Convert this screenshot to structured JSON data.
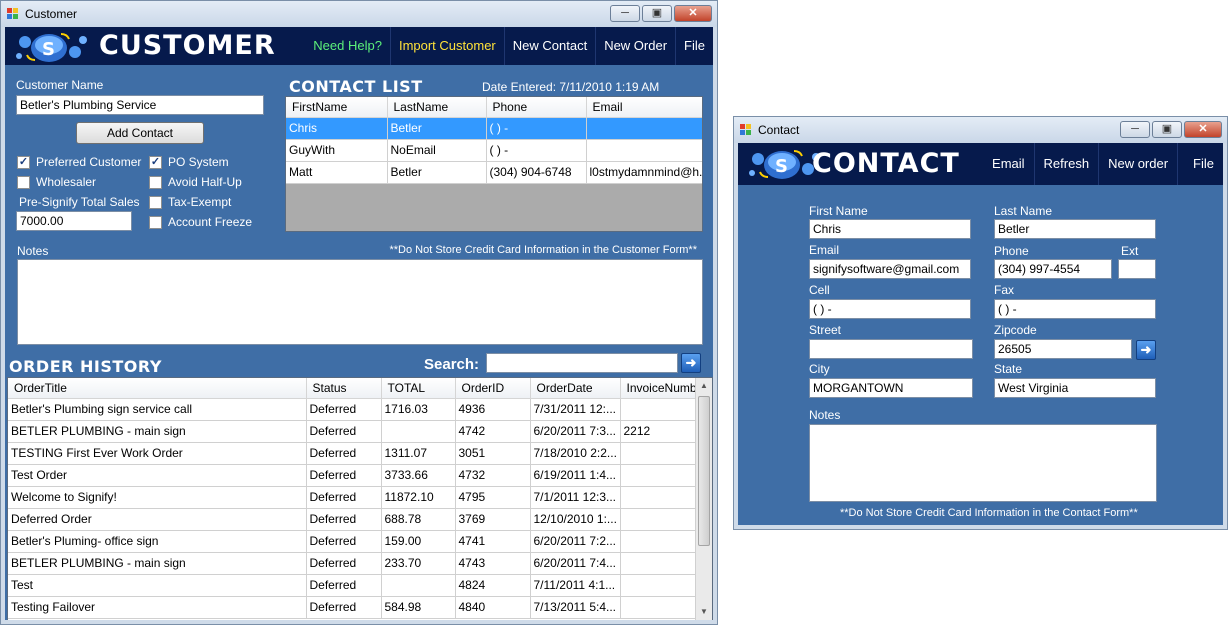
{
  "customer_window": {
    "title": "Customer",
    "brand": "CUSTOMER",
    "menu": [
      {
        "label": "Need Help?",
        "color": "#5cf07a"
      },
      {
        "label": "Import Customer",
        "color": "#ffe23a"
      },
      {
        "label": "New Contact",
        "color": "#ffffff"
      },
      {
        "label": "New Order",
        "color": "#ffffff"
      },
      {
        "label": "File",
        "color": "#ffffff"
      }
    ],
    "customer_name_label": "Customer Name",
    "customer_name_value": "Betler's Plumbing Service",
    "add_contact_label": "Add Contact",
    "checkboxes": {
      "preferred_customer": {
        "label": "Preferred Customer",
        "checked": "✓"
      },
      "po_system": {
        "label": "PO System",
        "checked": "✓"
      },
      "wholesaler": {
        "label": "Wholesaler",
        "checked": ""
      },
      "avoid_half_up": {
        "label": "Avoid Half-Up",
        "checked": ""
      },
      "tax_exempt": {
        "label": "Tax-Exempt",
        "checked": ""
      },
      "account_freeze": {
        "label": "Account Freeze",
        "checked": ""
      }
    },
    "pre_signify_label": "Pre-Signify Total Sales",
    "pre_signify_value": "7000.00",
    "contact_list_title": "CONTACT LIST",
    "date_entered": "Date Entered: 7/11/2010 1:19 AM",
    "contact_columns": [
      "FirstName",
      "LastName",
      "Phone",
      "Email"
    ],
    "contact_rows": [
      [
        "Chris",
        "Betler",
        "(   )    -",
        ""
      ],
      [
        "GuyWith",
        "NoEmail",
        "(   )    -",
        ""
      ],
      [
        "Matt",
        "Betler",
        "(304) 904-6748",
        "l0stmydamnmind@h..."
      ]
    ],
    "notes_label": "Notes",
    "notes_warning": "**Do Not Store Credit Card Information in the Customer Form**",
    "order_history_title": "ORDER HISTORY",
    "search_label": "Search:",
    "search_value": "",
    "order_columns": [
      "OrderTitle",
      "Status",
      "TOTAL",
      "OrderID",
      "OrderDate",
      "InvoiceNumbe"
    ],
    "order_rows": [
      [
        "Betler's Plumbing sign service call",
        "Deferred",
        "1716.03",
        "4936",
        "7/31/2011 12:...",
        ""
      ],
      [
        "BETLER PLUMBING - main sign",
        "Deferred",
        "",
        "4742",
        "6/20/2011 7:3...",
        "2212"
      ],
      [
        "TESTING First Ever Work Order",
        "Deferred",
        "1311.07",
        "3051",
        "7/18/2010 2:2...",
        ""
      ],
      [
        "Test Order",
        "Deferred",
        "3733.66",
        "4732",
        "6/19/2011 1:4...",
        ""
      ],
      [
        "Welcome to Signify!",
        "Deferred",
        "11872.10",
        "4795",
        "7/1/2011 12:3...",
        ""
      ],
      [
        "Deferred Order",
        "Deferred",
        "688.78",
        "3769",
        "12/10/2010 1:...",
        ""
      ],
      [
        "Betler's Pluming- office sign",
        "Deferred",
        "159.00",
        "4741",
        "6/20/2011 7:2...",
        ""
      ],
      [
        "BETLER PLUMBING - main sign",
        "Deferred",
        "233.70",
        "4743",
        "6/20/2011 7:4...",
        ""
      ],
      [
        "Test",
        "Deferred",
        "",
        "4824",
        "7/11/2011 4:1...",
        ""
      ],
      [
        "Testing Failover",
        "Deferred",
        "584.98",
        "4840",
        "7/13/2011 5:4...",
        ""
      ]
    ]
  },
  "contact_window": {
    "title": "Contact",
    "brand": "CONTACT",
    "menu": [
      "Email",
      "Refresh",
      "New order",
      "File"
    ],
    "fields": {
      "first_name": {
        "label": "First Name",
        "value": "Chris"
      },
      "last_name": {
        "label": "Last Name",
        "value": "Betler"
      },
      "email": {
        "label": "Email",
        "value": "signifysoftware@gmail.com"
      },
      "phone": {
        "label": "Phone",
        "value": "(304) 997-4554"
      },
      "ext": {
        "label": "Ext",
        "value": ""
      },
      "cell": {
        "label": "Cell",
        "value": "(   )    -"
      },
      "fax": {
        "label": "Fax",
        "value": "(   )    -"
      },
      "street": {
        "label": "Street",
        "value": ""
      },
      "zipcode": {
        "label": "Zipcode",
        "value": "26505"
      },
      "city": {
        "label": "City",
        "value": "MORGANTOWN"
      },
      "state": {
        "label": "State",
        "value": "West Virginia"
      }
    },
    "notes_label": "Notes",
    "notes_warning": "**Do Not Store Credit Card Information in the Contact Form**"
  },
  "icons": [
    "app-icon",
    "minimize-icon",
    "maximize-icon",
    "close-icon",
    "signify-logo",
    "arrow-right-icon",
    "scroll-up-icon",
    "scroll-down-icon",
    "check-icon"
  ],
  "colors": {
    "header": "#061a4c",
    "body": "#3f6ea6",
    "selection": "#3399ff",
    "help_link": "#5cf07a",
    "import_link": "#ffe23a"
  }
}
